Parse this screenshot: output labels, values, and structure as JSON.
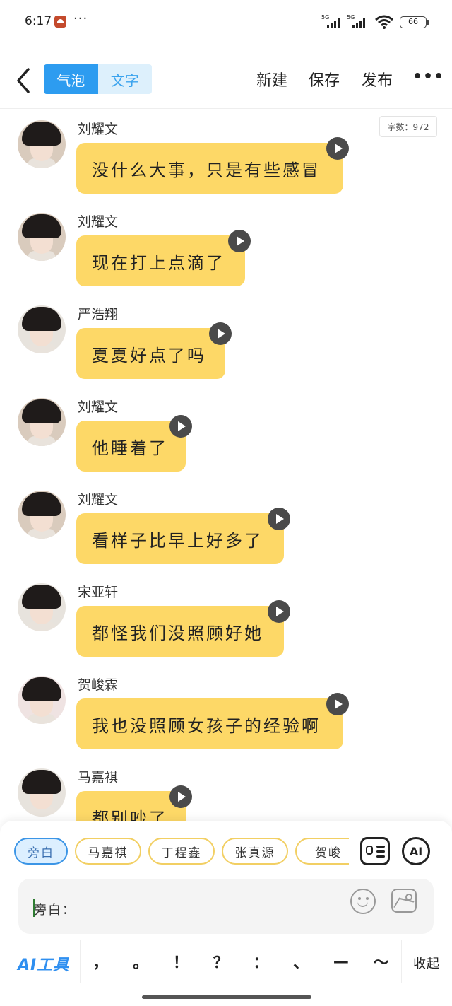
{
  "status_bar": {
    "time": "6:17",
    "more": "···",
    "signal_label_1": "5G",
    "signal_label_2": "5G",
    "battery": "66"
  },
  "header": {
    "mode_tabs": [
      {
        "label": "气泡",
        "active": true
      },
      {
        "label": "文字",
        "active": false
      }
    ],
    "actions": {
      "new": "新建",
      "save": "保存",
      "publish": "发布"
    },
    "more": "•••"
  },
  "word_count": "字数：972",
  "messages": [
    {
      "sender": "刘耀文",
      "text": "没什么大事，只是有些感冒"
    },
    {
      "sender": "刘耀文",
      "text": "现在打上点滴了"
    },
    {
      "sender": "严浩翔",
      "text": "夏夏好点了吗"
    },
    {
      "sender": "刘耀文",
      "text": "他睡着了"
    },
    {
      "sender": "刘耀文",
      "text": "看样子比早上好多了"
    },
    {
      "sender": "宋亚轩",
      "text": "都怪我们没照顾好她"
    },
    {
      "sender": "贺峻霖",
      "text": "我也没照顾女孩子的经验啊"
    },
    {
      "sender": "马嘉祺",
      "text": "都别吵了"
    }
  ],
  "roles": [
    {
      "label": "旁白",
      "active": true
    },
    {
      "label": "马嘉祺",
      "active": false
    },
    {
      "label": "丁程鑫",
      "active": false
    },
    {
      "label": "张真源",
      "active": false
    },
    {
      "label": "贺峻",
      "active": false
    }
  ],
  "ai_button": "AI",
  "input": {
    "value": "旁白："
  },
  "toolbar": {
    "ai_tools": "AI工具",
    "punctuation": [
      "，",
      "。",
      "！",
      "？",
      "：",
      "、",
      "—",
      "～"
    ],
    "collapse": "收起"
  },
  "colors": {
    "bubble": "#fdd867",
    "accent": "#2d9cf0",
    "play_button": "#4a4a4a"
  }
}
